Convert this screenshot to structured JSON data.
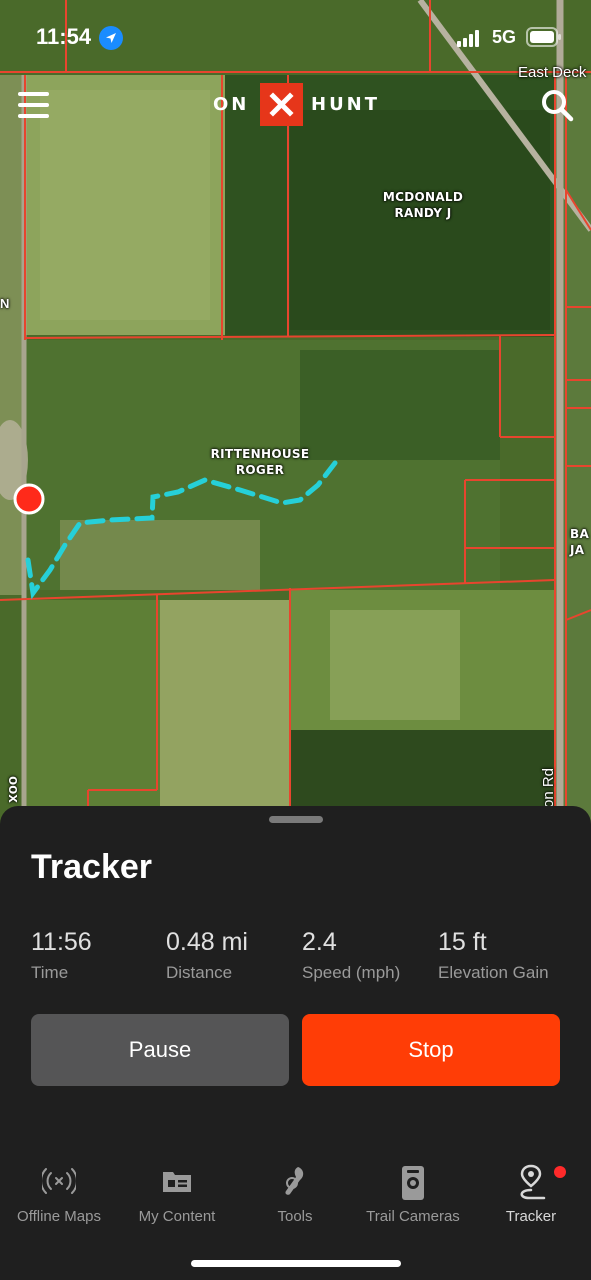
{
  "status_bar": {
    "time": "11:54",
    "network": "5G"
  },
  "header": {
    "logo_left": "ON",
    "logo_mark": "X",
    "logo_right": "HUNT",
    "menu_icon": "hamburger-icon",
    "search_icon": "search-icon"
  },
  "map": {
    "parcel_labels": [
      {
        "lines": [
          "MCDONALD",
          "RANDY J"
        ]
      },
      {
        "lines": [
          "RITTENHOUSE",
          "ROGER"
        ]
      },
      {
        "lines": [
          "BA",
          "JA"
        ]
      }
    ],
    "road_labels": [
      "East Deck",
      "on Rd",
      "oox",
      "N"
    ],
    "track_color": "#26d0d8",
    "parcel_line_color": "#e8452e",
    "start_marker_color": "#ff2a1a"
  },
  "tracker": {
    "title": "Tracker",
    "stats": [
      {
        "value": "11:56",
        "label": "Time"
      },
      {
        "value": "0.48 mi",
        "label": "Distance"
      },
      {
        "value": "2.4",
        "label": "Speed (mph)"
      },
      {
        "value": "15 ft",
        "label": "Elevation Gain"
      }
    ],
    "pause_label": "Pause",
    "stop_label": "Stop"
  },
  "tabs": [
    {
      "label": "Offline Maps",
      "icon": "offline-signal-icon"
    },
    {
      "label": "My Content",
      "icon": "folder-icon"
    },
    {
      "label": "Tools",
      "icon": "tools-icon"
    },
    {
      "label": "Trail Cameras",
      "icon": "trail-camera-icon"
    },
    {
      "label": "Tracker",
      "icon": "tracker-pin-icon",
      "active": true,
      "badge": true
    }
  ],
  "colors": {
    "accent": "#ff3d06",
    "pause": "#555556",
    "sheet_bg": "#1f1f1f",
    "brand_red": "#e6361a"
  }
}
